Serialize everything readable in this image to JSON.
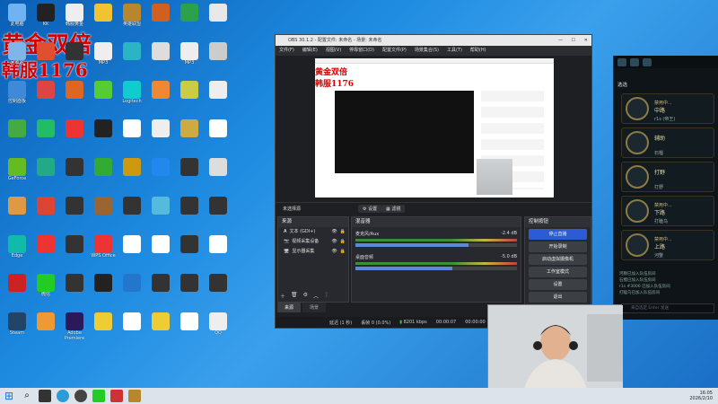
{
  "promo": {
    "line1": "黄金双倍",
    "line2": "韩服",
    "line2_num": "1176"
  },
  "desktop_icons": [
    {
      "label": "此电脑",
      "color": "#6fb3f2"
    },
    {
      "label": "KK",
      "color": "#222"
    },
    {
      "label": "韩服黄金",
      "color": "#eee"
    },
    {
      "label": "",
      "color": "#f1c232"
    },
    {
      "label": "英雄联盟",
      "color": "#b8862c"
    },
    {
      "label": "",
      "color": "#d06020"
    },
    {
      "label": "",
      "color": "#2aa14a"
    },
    {
      "label": "",
      "color": "#e8e8e8"
    },
    {
      "label": "回收站",
      "color": "#7fb5e8"
    },
    {
      "label": "",
      "color": "#e05030"
    },
    {
      "label": "",
      "color": "#333"
    },
    {
      "label": "MP3",
      "color": "#eee"
    },
    {
      "label": "",
      "color": "#2ab4c4"
    },
    {
      "label": "",
      "color": "#ddd"
    },
    {
      "label": "MP3",
      "color": "#eee"
    },
    {
      "label": "",
      "color": "#ccc"
    },
    {
      "label": "控制面板",
      "color": "#3f8ad8"
    },
    {
      "label": "",
      "color": "#d44"
    },
    {
      "label": "",
      "color": "#d62"
    },
    {
      "label": "",
      "color": "#5c3"
    },
    {
      "label": "Logitech",
      "color": "#1cc"
    },
    {
      "label": "",
      "color": "#e83"
    },
    {
      "label": "",
      "color": "#cc4"
    },
    {
      "label": "",
      "color": "#eee"
    },
    {
      "label": "",
      "color": "#4a4"
    },
    {
      "label": "",
      "color": "#2b6"
    },
    {
      "label": "",
      "color": "#e33"
    },
    {
      "label": "",
      "color": "#222"
    },
    {
      "label": "",
      "color": "#fff"
    },
    {
      "label": "",
      "color": "#eee"
    },
    {
      "label": "",
      "color": "#ca4"
    },
    {
      "label": "",
      "color": "#fff"
    },
    {
      "label": "GeForce",
      "color": "#6b2"
    },
    {
      "label": "",
      "color": "#2a8"
    },
    {
      "label": "",
      "color": "#333"
    },
    {
      "label": "",
      "color": "#3a3"
    },
    {
      "label": "",
      "color": "#c91"
    },
    {
      "label": "",
      "color": "#28e"
    },
    {
      "label": "",
      "color": "#333"
    },
    {
      "label": "",
      "color": "#ddd"
    },
    {
      "label": "",
      "color": "#d94"
    },
    {
      "label": "",
      "color": "#d43"
    },
    {
      "label": "",
      "color": "#333"
    },
    {
      "label": "",
      "color": "#963"
    },
    {
      "label": "",
      "color": "#333"
    },
    {
      "label": "",
      "color": "#5bd"
    },
    {
      "label": "",
      "color": "#333"
    },
    {
      "label": "",
      "color": "#333"
    },
    {
      "label": "Edge",
      "color": "#1ba"
    },
    {
      "label": "",
      "color": "#e33"
    },
    {
      "label": "",
      "color": "#333"
    },
    {
      "label": "WPS Office",
      "color": "#e33"
    },
    {
      "label": "",
      "color": "#fff"
    },
    {
      "label": "",
      "color": "#fff"
    },
    {
      "label": "",
      "color": "#333"
    },
    {
      "label": "",
      "color": "#fff"
    },
    {
      "label": "",
      "color": "#c22"
    },
    {
      "label": "微信",
      "color": "#2c2"
    },
    {
      "label": "",
      "color": "#333"
    },
    {
      "label": "",
      "color": "#222"
    },
    {
      "label": "",
      "color": "#27c"
    },
    {
      "label": "",
      "color": "#333"
    },
    {
      "label": "",
      "color": "#333"
    },
    {
      "label": "",
      "color": "#333"
    },
    {
      "label": "Steam",
      "color": "#246"
    },
    {
      "label": "",
      "color": "#e93"
    },
    {
      "label": "Adobe Premiere",
      "color": "#2a1a5c"
    },
    {
      "label": "",
      "color": "#ec3"
    },
    {
      "label": "",
      "color": "#fff"
    },
    {
      "label": "",
      "color": "#ec3"
    },
    {
      "label": "",
      "color": "#fff"
    },
    {
      "label": "QQ",
      "color": "#eee"
    }
  ],
  "obs": {
    "title": "OBS 30.1.2 - 配置文件: 未命名 - 场景: 未命名",
    "menu": [
      "文件(F)",
      "编辑(E)",
      "视图(V)",
      "停靠窗口(D)",
      "配置文件(P)",
      "场景集合(S)",
      "工具(T)",
      "帮助(H)"
    ],
    "no_source": "未选择源",
    "settings_btn": "设置",
    "filter_btn": "滤镜",
    "sources_title": "来源",
    "sources": [
      "文本 (GDI+)",
      "视频采集设备",
      "显示器采集"
    ],
    "mixer_title": "混音器",
    "mixer": [
      {
        "name": "麦克风/Aux",
        "db": "-2.4 dB",
        "level": 0.7
      },
      {
        "name": "桌面音频",
        "db": "-5.0 dB",
        "level": 0.6
      }
    ],
    "controls_title": "控制按钮",
    "controls": [
      "停止直播",
      "开始录制",
      "启动虚拟摄像机",
      "工作室模式",
      "设置",
      "退出"
    ],
    "tabs": [
      "来源",
      "场景"
    ],
    "status": {
      "delay": "延迟 (1 秒)",
      "dropped": "丢帧 0 (0.0%)",
      "bitrate": "8201 kbps",
      "time": "00:00:07",
      "time2": "00:00:00"
    }
  },
  "game": {
    "tab": "选选",
    "players": [
      {
        "name": "禁用中...",
        "role": "中路",
        "sub": "r1s (帝王)"
      },
      {
        "name": "",
        "role": "辅助",
        "sub": "石榴"
      },
      {
        "name": "",
        "role": "打野",
        "sub": "打野"
      },
      {
        "name": "禁用中...",
        "role": "下路",
        "sub": "打瞌乌"
      },
      {
        "name": "禁用中...",
        "role": "上路",
        "sub": "河蟹"
      }
    ],
    "chat": [
      "河豚已加入队伍房间",
      "石榴已加入队伍房间",
      "r1s #3006 已加入队伍房间",
      "打瞌乌已加入队伍房间"
    ],
    "chat_placeholder": "来自选定 Enter 发送"
  },
  "clock": {
    "time": "16:05",
    "date": "2026/2/10"
  }
}
